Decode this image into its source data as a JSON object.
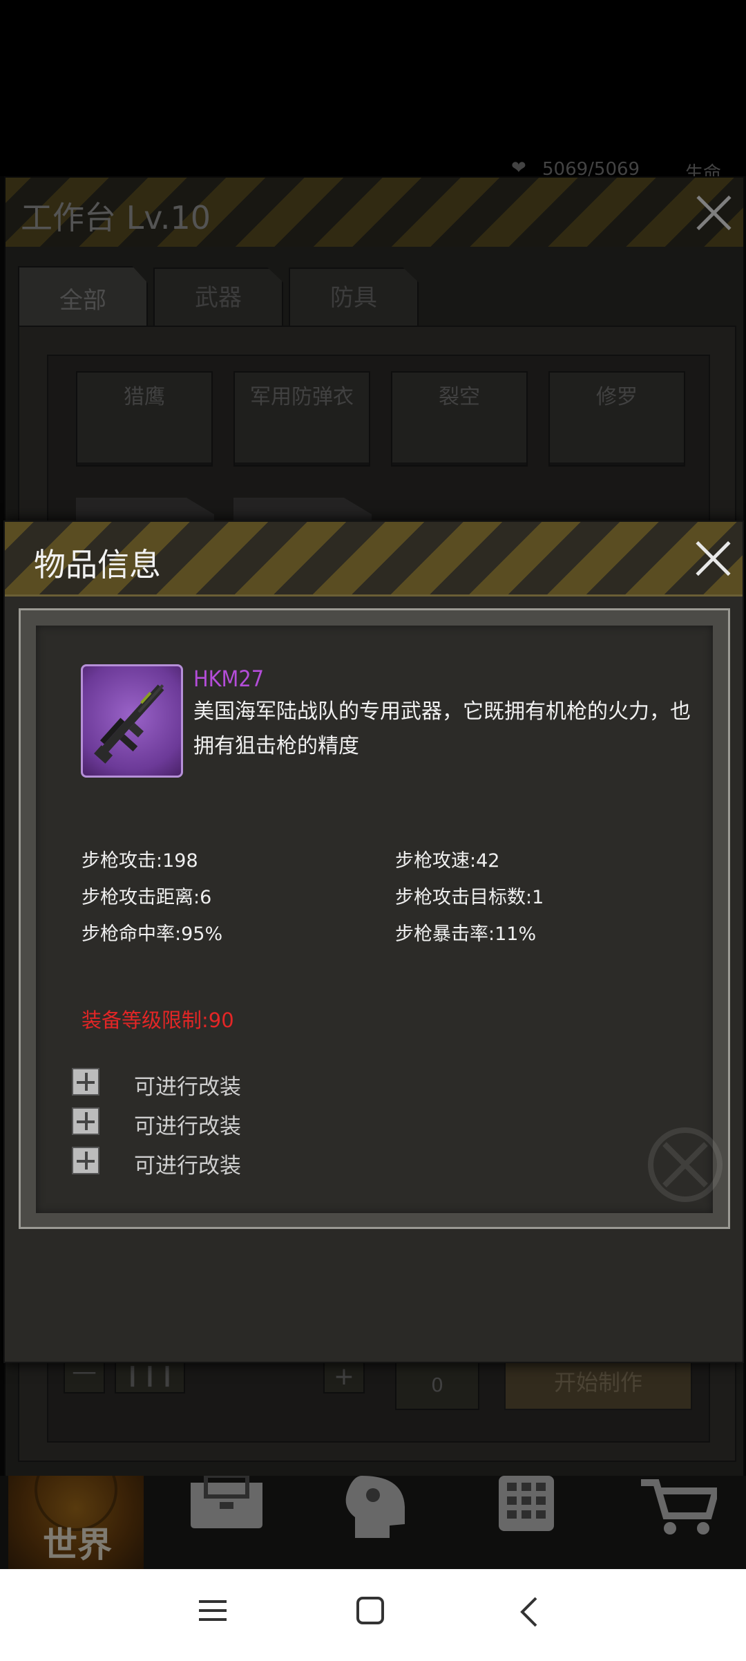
{
  "status": {
    "hp": "5069/5069",
    "hp_label": "生命"
  },
  "workbench": {
    "title": "工作台 Lv.10",
    "tabs": [
      {
        "label": "全部",
        "active": true
      },
      {
        "label": "武器",
        "active": false
      },
      {
        "label": "防具",
        "active": false
      }
    ],
    "recipes": [
      "猎鹰",
      "军用防弹衣",
      "裂空",
      "修罗"
    ],
    "quantity": "0",
    "craft_button": "开始制作"
  },
  "nav": {
    "world_label": "世界"
  },
  "modal": {
    "title": "物品信息",
    "item": {
      "name": "HKM27",
      "description": "美国海军陆战队的专用武器，它既拥有机枪的火力，也拥有狙击枪的精度"
    },
    "stats": [
      "步枪攻击:198",
      "步枪攻速:42",
      "步枪攻击距离:6",
      "步枪攻击目标数:1",
      "步枪命中率:95%",
      "步枪暴击率:11%"
    ],
    "requirement": "装备等级限制:90",
    "mod_slots": [
      "可进行改装",
      "可进行改装",
      "可进行改装"
    ]
  },
  "colors": {
    "item_name": "#b44dd9",
    "requirement": "#e32626",
    "rarity_purple": "#7b44a8",
    "hazard_yellow": "#5a4d22"
  }
}
